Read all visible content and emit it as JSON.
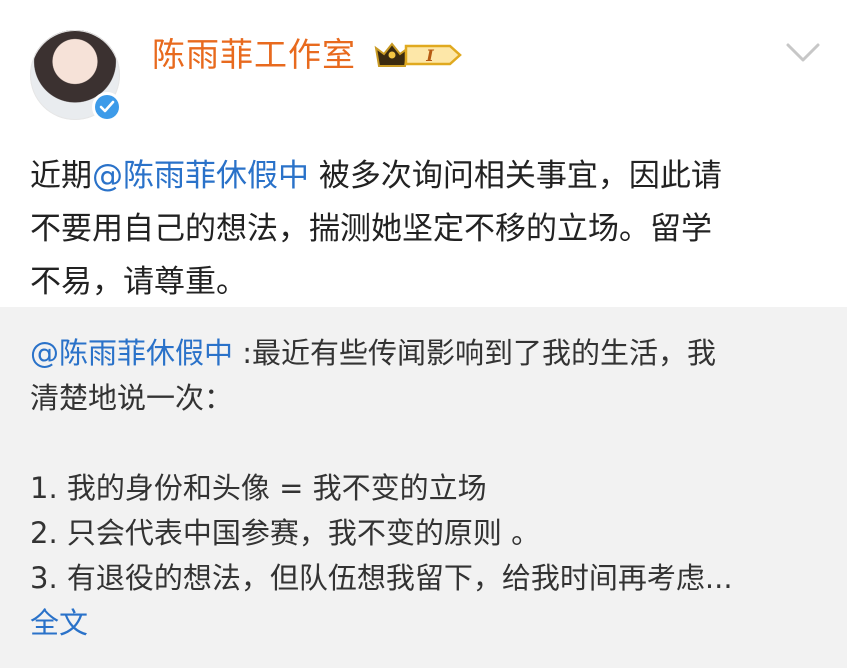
{
  "header": {
    "author_name": "陈雨菲工作室",
    "vip_level": "I"
  },
  "post": {
    "prefix": "近期",
    "mention": "@陈雨菲休假中",
    "line1_rest": " 被多次询问相关事宜，因此请",
    "line2": "不要用自己的想法，揣测她坚定不移的立场。留学",
    "line3": "不易，请尊重。"
  },
  "repost": {
    "mention": "@陈雨菲休假中",
    "line1_rest": " :最近有些传闻影响到了我的生活，我",
    "line2": "清楚地说一次：",
    "items": [
      "1. 我的身份和头像 = 我不变的立场",
      "2. 只会代表中国参赛，我不变的原则 。",
      "3. 有退役的想法，但队伍想我留下，给我时间再考虑..."
    ],
    "full_text_link": "全文"
  }
}
